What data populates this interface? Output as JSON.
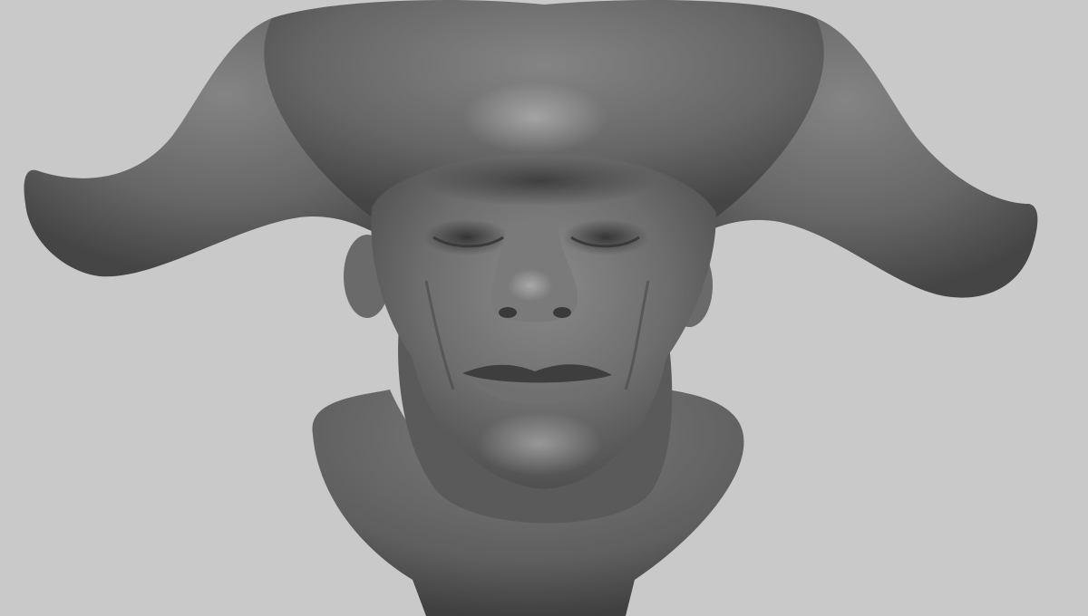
{
  "scene": {
    "subject": "horned-head-sculpt",
    "background_color": "#c9c9c9",
    "material_color": "#6f6f6f"
  }
}
